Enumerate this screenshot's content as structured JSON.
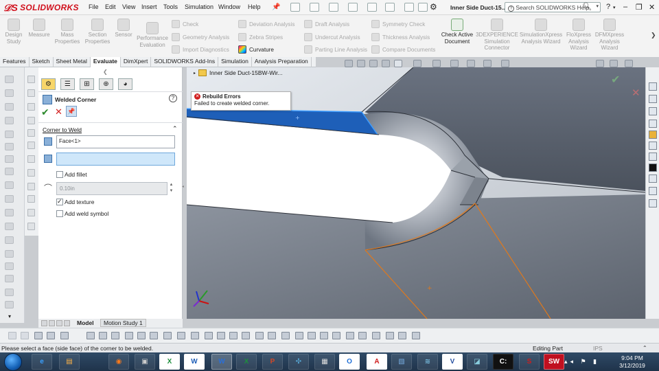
{
  "app": {
    "brand": "SOLIDWORKS",
    "brand_color": "#d0101c"
  },
  "menu": [
    "File",
    "Edit",
    "View",
    "Insert",
    "Tools",
    "Simulation",
    "Window",
    "Help"
  ],
  "document_title": "Inner Side Duct-15...",
  "search": {
    "placeholder": "Search SOLIDWORKS Help"
  },
  "ribbon": {
    "big_buttons": [
      "Design Study",
      "Measure",
      "Mass Properties",
      "Section Properties",
      "Sensor",
      "Performance Evaluation"
    ],
    "col1": [
      "Check",
      "Geometry Analysis",
      "Import Diagnostics"
    ],
    "col2": [
      "Deviation Analysis",
      "Zebra Stripes",
      "Curvature"
    ],
    "col3": [
      "Draft Analysis",
      "Undercut Analysis",
      "Parting Line Analysis"
    ],
    "col4": [
      "Symmetry Check",
      "Thickness Analysis",
      "Compare Documents"
    ],
    "check_active": "Check Active Document",
    "right_buttons": [
      "3DEXPERIENCE Simulation Connector",
      "SimulationXpress Analysis Wizard",
      "FloXpress Analysis Wizard",
      "DFMXpress Analysis Wizard"
    ]
  },
  "command_tabs": [
    {
      "label": "Features",
      "active": false
    },
    {
      "label": "Sketch",
      "active": false
    },
    {
      "label": "Sheet Metal",
      "active": false
    },
    {
      "label": "Evaluate",
      "active": true
    },
    {
      "label": "DimXpert",
      "active": false
    },
    {
      "label": "SOLIDWORKS Add-Ins",
      "active": false
    },
    {
      "label": "Simulation",
      "active": false
    },
    {
      "label": "Analysis Preparation",
      "active": false
    }
  ],
  "feature_tree": {
    "root": "Inner Side Duct-15BW-Wir..."
  },
  "tooltip": {
    "title": "Rebuild Errors",
    "message": "Failed to create welded corner."
  },
  "property_manager": {
    "title": "Welded Corner",
    "group_title": "Corner to Weld",
    "face_value": "Face<1>",
    "second_value": "",
    "add_fillet": {
      "label": "Add fillet",
      "checked": false
    },
    "radius": "0.10in",
    "add_texture": {
      "label": "Add texture",
      "checked": true
    },
    "add_weld_symbol": {
      "label": "Add weld symbol",
      "checked": false
    }
  },
  "bottom_tabs": {
    "model": "Model",
    "motion_study": "Motion Study 1"
  },
  "status": {
    "message": "Please select a face (side face) of the corner to be welded.",
    "mode": "Editing Part",
    "units": "IPS"
  },
  "clock": {
    "time": "9:04 PM",
    "date": "3/12/2019"
  },
  "taskbar_apps": [
    "IE",
    "Firefox",
    "Terminal",
    "Excel",
    "Word",
    "Word",
    "Excel",
    "PowerPoint",
    "Network",
    "Calculator",
    "Outlook",
    "PDF",
    "Photos",
    "Wi-Fi",
    "Visio",
    "Files",
    "Cmd",
    "SOLIDWORKS",
    "SW 2017"
  ]
}
